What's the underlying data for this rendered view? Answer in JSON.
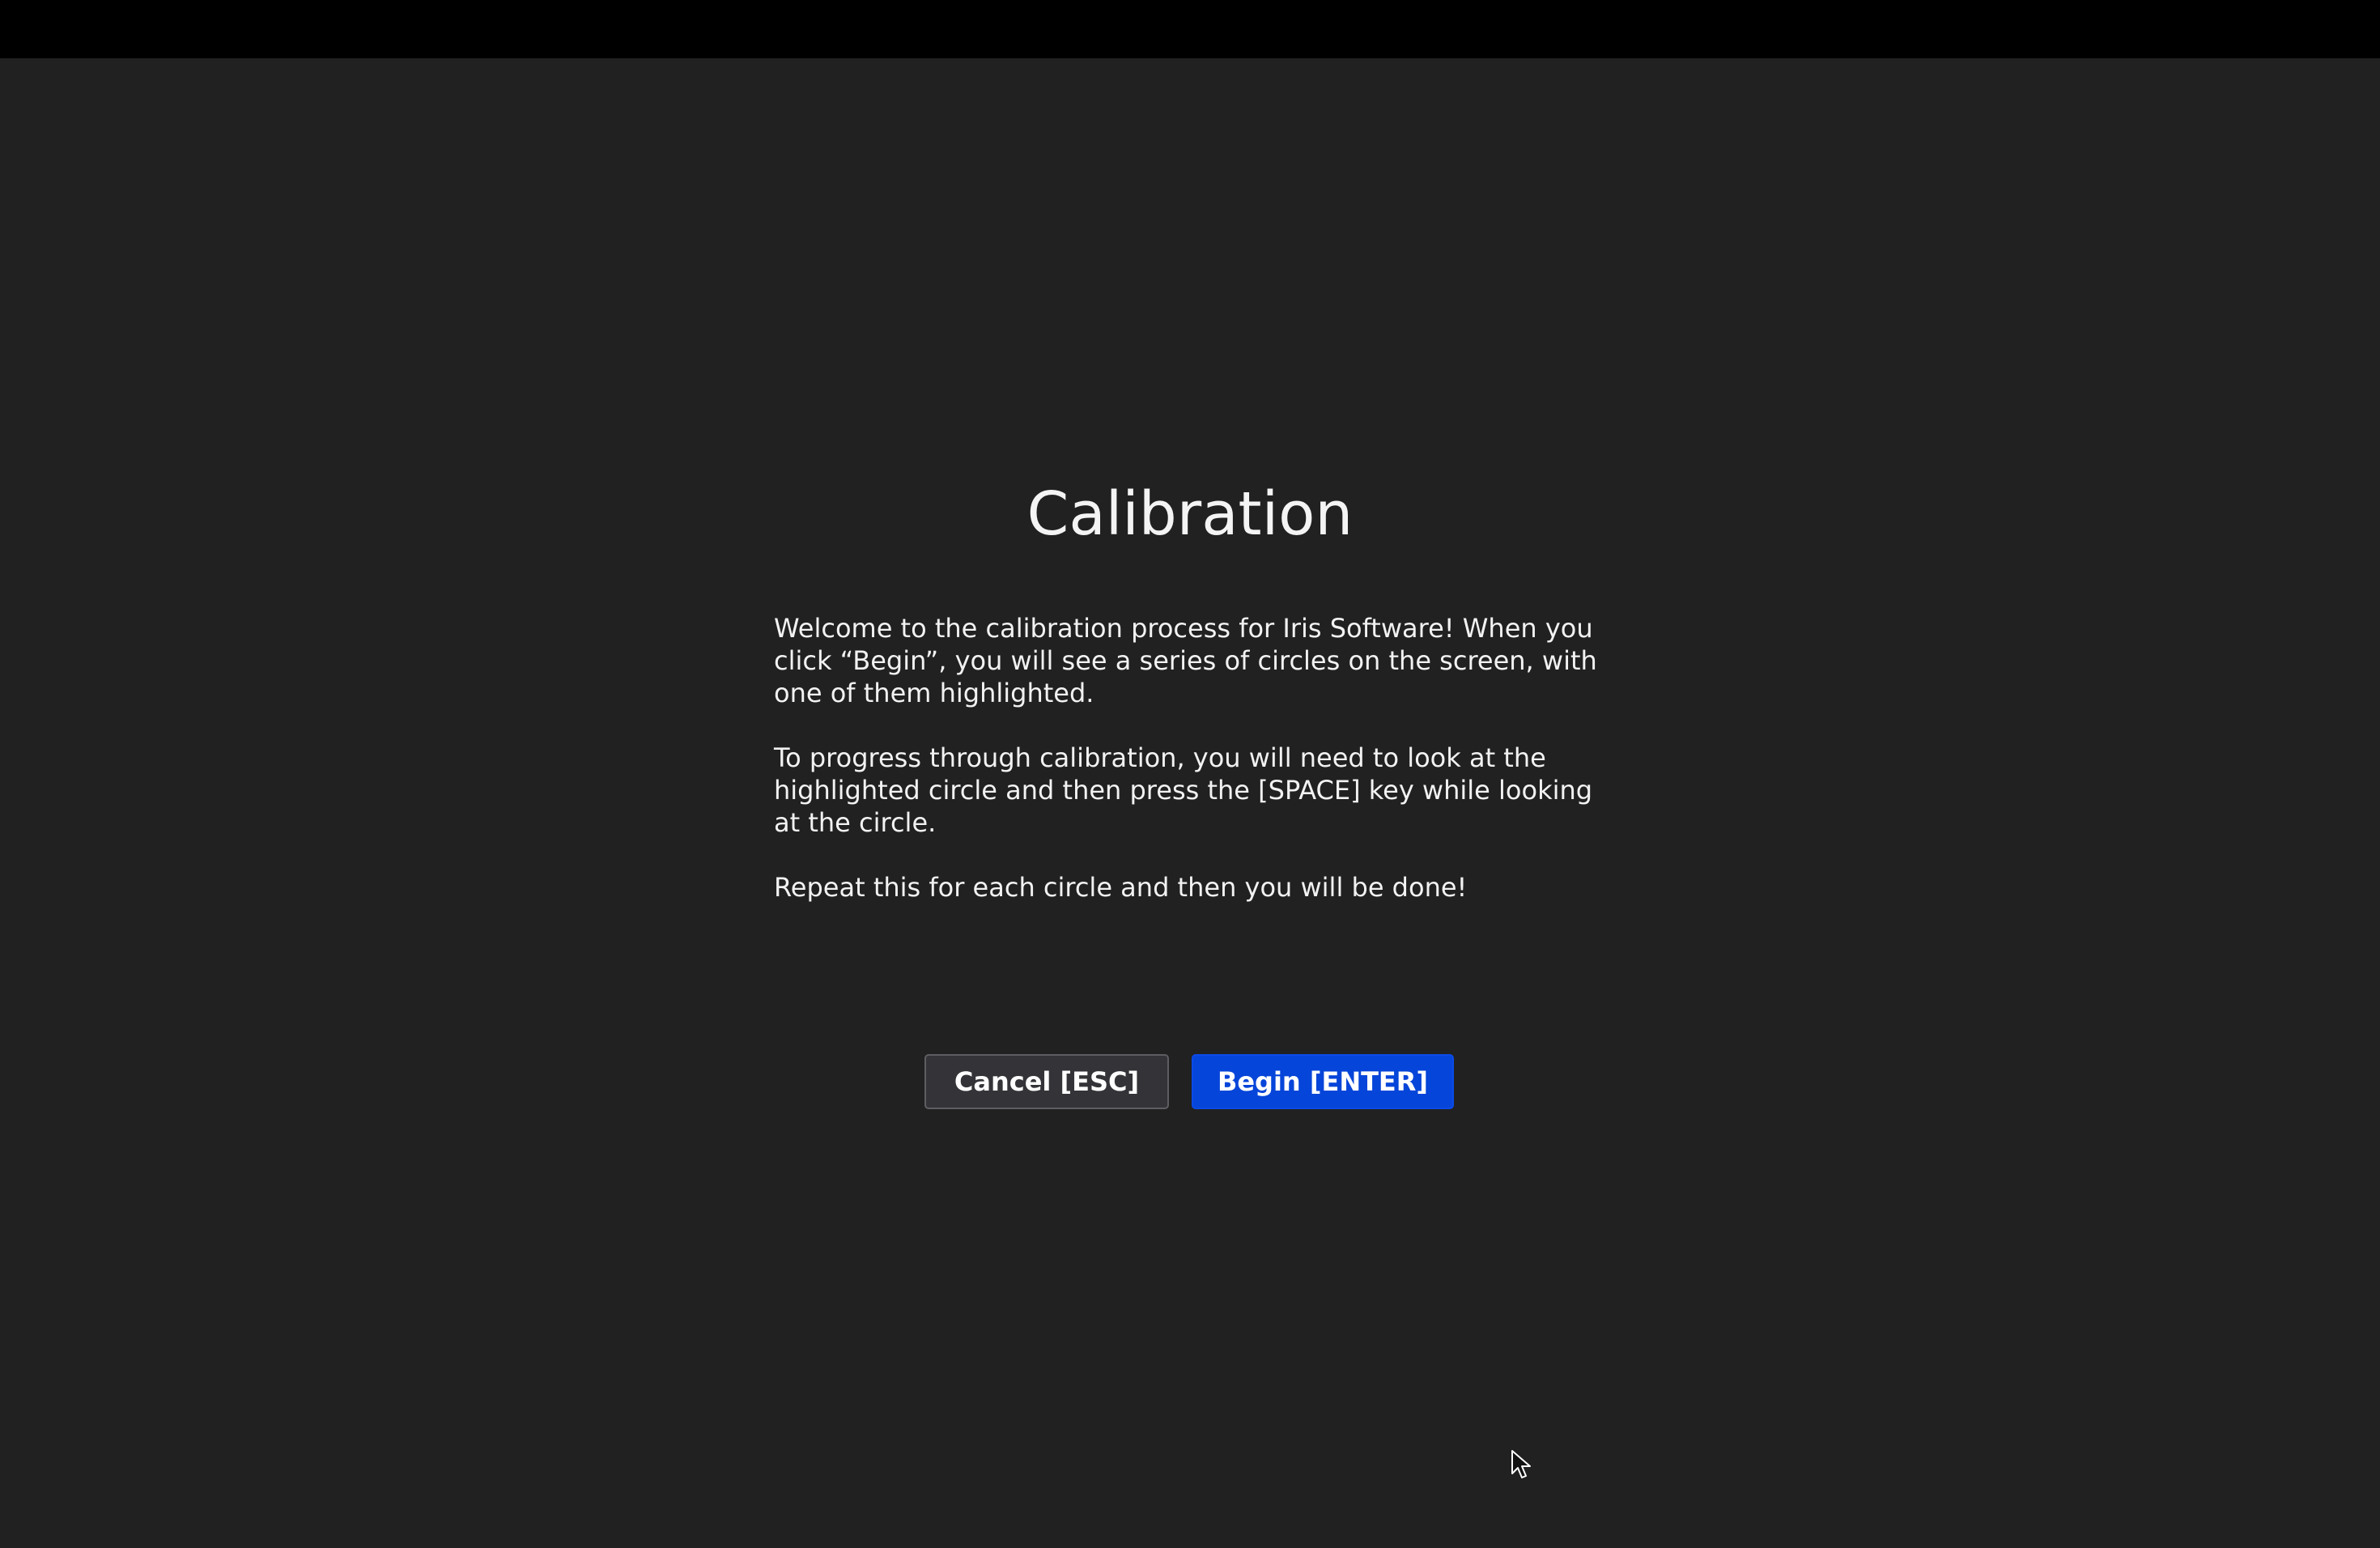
{
  "title": "Calibration",
  "paragraphs": [
    "Welcome to the calibration process for Iris Software! When you click “Begin”, you will see a series of circles on the screen, with one of them highlighted.",
    "To progress through calibration, you will need to look at the highlighted circle and then press the [SPACE] key while looking at the circle.",
    "Repeat this for each circle and then you will be done!"
  ],
  "buttons": {
    "cancel_label": "Cancel [ESC]",
    "begin_label": "Begin [ENTER]"
  },
  "colors": {
    "background": "#212121",
    "top_bar": "#000000",
    "accent": "#0645d9",
    "cancel_bg": "#343438"
  },
  "icons": {
    "cursor": "mouse-pointer-icon"
  }
}
